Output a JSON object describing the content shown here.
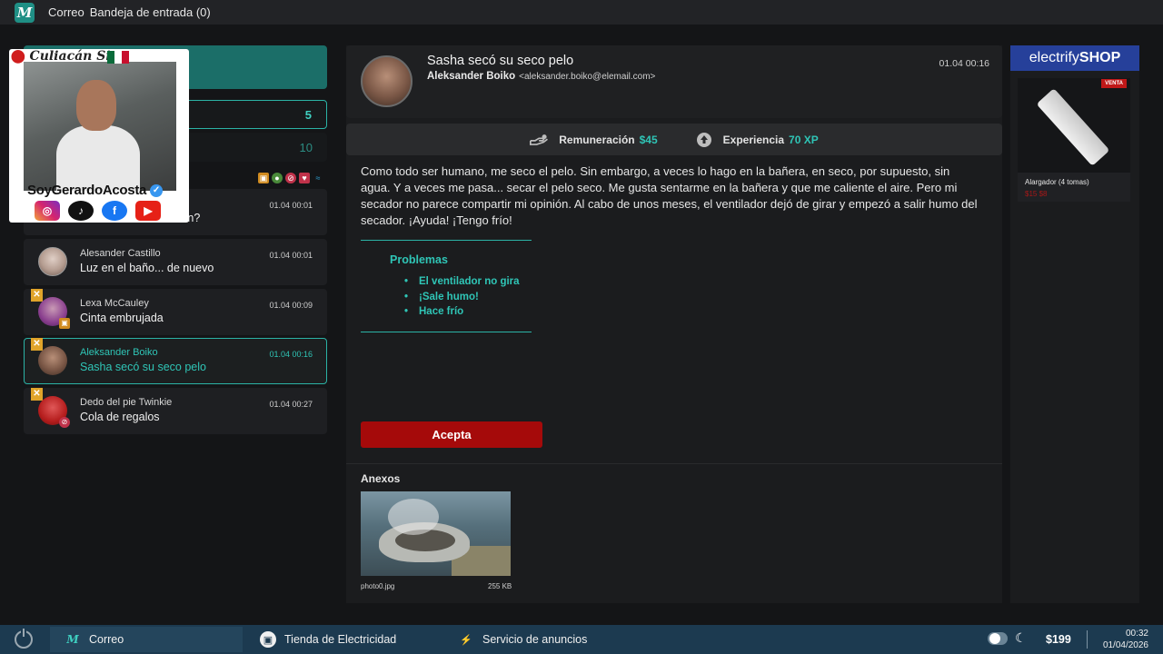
{
  "topbar": {
    "app": "Correo",
    "title": "Bandeja de entrada (0)",
    "logo": "M"
  },
  "left": {
    "folders": [
      {
        "count": "5"
      },
      {
        "count": "10"
      }
    ],
    "mails": [
      {
        "from": "",
        "subject": "...n?",
        "time": "01.04 00:01"
      },
      {
        "from": "Alesander Castillo",
        "subject": "Luz en el baño... de nuevo",
        "time": "01.04 00:01"
      },
      {
        "from": "Lexa McCauley",
        "subject": "Cinta embrujada",
        "time": "01.04 00:09"
      },
      {
        "from": "Aleksander Boiko",
        "subject": "Sasha secó su seco pelo",
        "time": "01.04 00:16"
      },
      {
        "from": "Dedo del pie Twinkie",
        "subject": "Cola de regalos",
        "time": "01.04 00:27"
      }
    ]
  },
  "overlay": {
    "location": "Culiacán Sin.",
    "handle": "SoyGerardoAcosta"
  },
  "message": {
    "subject": "Sasha secó su seco pelo",
    "sender_name": "Aleksander Boiko",
    "sender_email": "<aleksander.boiko@elemail.com>",
    "time": "01.04 00:16",
    "reward_label": "Remuneración",
    "reward_value": "$45",
    "xp_label": "Experiencia",
    "xp_value": "70 XP",
    "body": "Como todo ser humano, me seco el pelo. Sin embargo, a veces lo hago en la bañera, en seco, por supuesto, sin agua. Y a veces me pasa... secar el pelo seco. Me gusta sentarme en la bañera y que me caliente el aire. Pero mi secador no parece compartir mi opinión. Al cabo de unos meses, el ventilador dejó de girar y empezó a salir humo del secador. ¡Ayuda! ¡Tengo frío!",
    "problems_title": "Problemas",
    "problems": [
      "El ventilador no gira",
      "¡Sale humo!",
      "Hace frío"
    ],
    "accept_label": "Acepta",
    "attachments_title": "Anexos",
    "attachment": {
      "name": "photo0.jpg",
      "size": "255 KB"
    }
  },
  "shop": {
    "brand_light": "electrify",
    "brand_bold": "SHOP",
    "sale_badge": "VENTA",
    "product_name": "Alargador (4 tomas)",
    "product_price": "$15 $8"
  },
  "taskbar": {
    "items": [
      "Correo",
      "Tienda de Electricidad",
      "Servicio de anuncios"
    ],
    "money": "$199",
    "time": "00:32",
    "date": "01/04/2026"
  },
  "colors": {
    "accent": "#2fc5b6",
    "accept": "#a50a0a",
    "shop": "#26409a",
    "taskbar": "#1c3a50"
  }
}
